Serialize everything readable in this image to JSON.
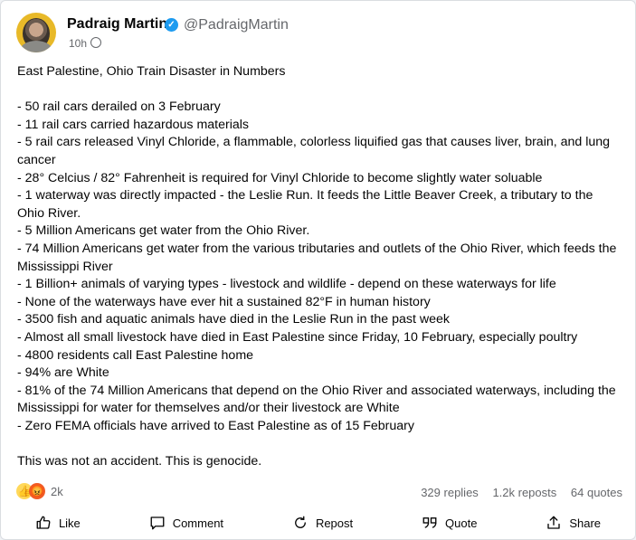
{
  "post": {
    "author": "Padraig Martin",
    "handle": "@PadraigMartin",
    "time": "10h",
    "title": "East Palestine, Ohio Train Disaster in Numbers",
    "items": [
      "- 50 rail cars derailed on 3 February",
      "- 11 rail cars carried hazardous materials",
      "- 5 rail cars released Vinyl Chloride, a flammable, colorless liquified gas that causes liver, brain, and lung cancer",
      "- 28° Celcius / 82° Fahrenheit is required for Vinyl Chloride to become slightly water soluable",
      "- 1 waterway was directly impacted - the Leslie Run. It feeds the Little Beaver Creek, a tributary to the Ohio River.",
      "- 5 Million Americans get water from the Ohio River.",
      "- 74 Million Americans get water from the various tributaries and outlets of the Ohio River, which feeds the Mississippi River",
      "- 1 Billion+ animals of varying types - livestock and wildlife - depend on these waterways for life",
      "- None of the waterways have ever hit a sustained 82°F in human history",
      "- 3500 fish and aquatic animals have died in the Leslie Run in the past week",
      "- Almost all small livestock have died in East Palestine since Friday, 10 February, especially poultry",
      "- 4800 residents call East Palestine home",
      "- 94% are White",
      "- 81% of the 74 Million Americans that depend on the Ohio River and associated waterways, including the Mississippi for water for themselves and/or their livestock are White",
      "- Zero FEMA officials have arrived to East Palestine as of 15 February"
    ],
    "closing": "This was not an accident. This is genocide."
  },
  "engagement": {
    "reactions_count": "2k",
    "replies": "329 replies",
    "reposts": "1.2k reposts",
    "quotes": "64 quotes"
  },
  "actions": {
    "like": "Like",
    "comment": "Comment",
    "repost": "Repost",
    "quote": "Quote",
    "share": "Share"
  },
  "icons": [
    "verified-icon",
    "globe-icon",
    "like-reaction-icon",
    "angry-reaction-icon",
    "thumbs-up-icon",
    "comment-icon",
    "repost-icon",
    "quote-icon",
    "share-icon"
  ],
  "colors": {
    "verified": "#1d9bf0",
    "secondary_text": "#65676b",
    "avatar_bg": "#e8b928"
  }
}
